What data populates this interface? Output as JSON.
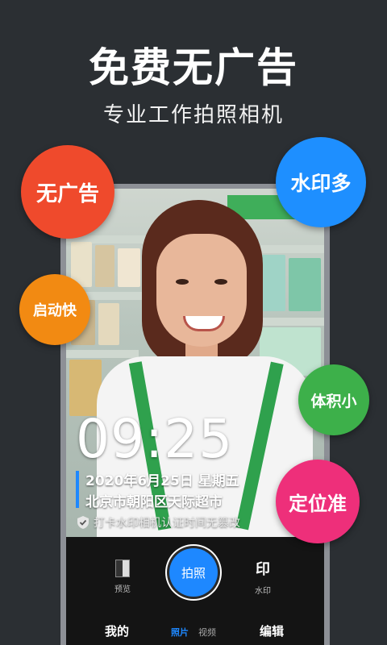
{
  "header": {
    "headline": "免费无广告",
    "subline": "专业工作拍照相机"
  },
  "bubbles": {
    "no_ads": "无广告",
    "many_watermarks": "水印多",
    "fast_start": "启动快",
    "small_size": "体积小",
    "accurate_location": "定位准"
  },
  "watermark": {
    "time": "09:25",
    "date": "2020年6月25日 星期五",
    "address": "北京市朝阳区天际超市",
    "verify_text": "打卡水印相机认证时间无篡改"
  },
  "camera": {
    "preview_label": "预览",
    "shutter_label": "拍照",
    "watermark_glyph": "印",
    "watermark_label": "水印",
    "tab_mine": "我的",
    "tab_photo": "照片",
    "tab_video": "视频",
    "tab_edit": "编辑"
  },
  "colors": {
    "background": "#2b2f33",
    "accent_blue": "#1e88ff",
    "bubble_red": "#ef4a2c",
    "bubble_blue": "#1e8fff",
    "bubble_orange": "#f28a12",
    "bubble_green": "#3db04a",
    "bubble_pink": "#ee2f7a"
  },
  "icons": {
    "verify": "shield-check-icon",
    "preview": "preview-thumbnail-icon",
    "watermark": "watermark-glyph-icon"
  }
}
